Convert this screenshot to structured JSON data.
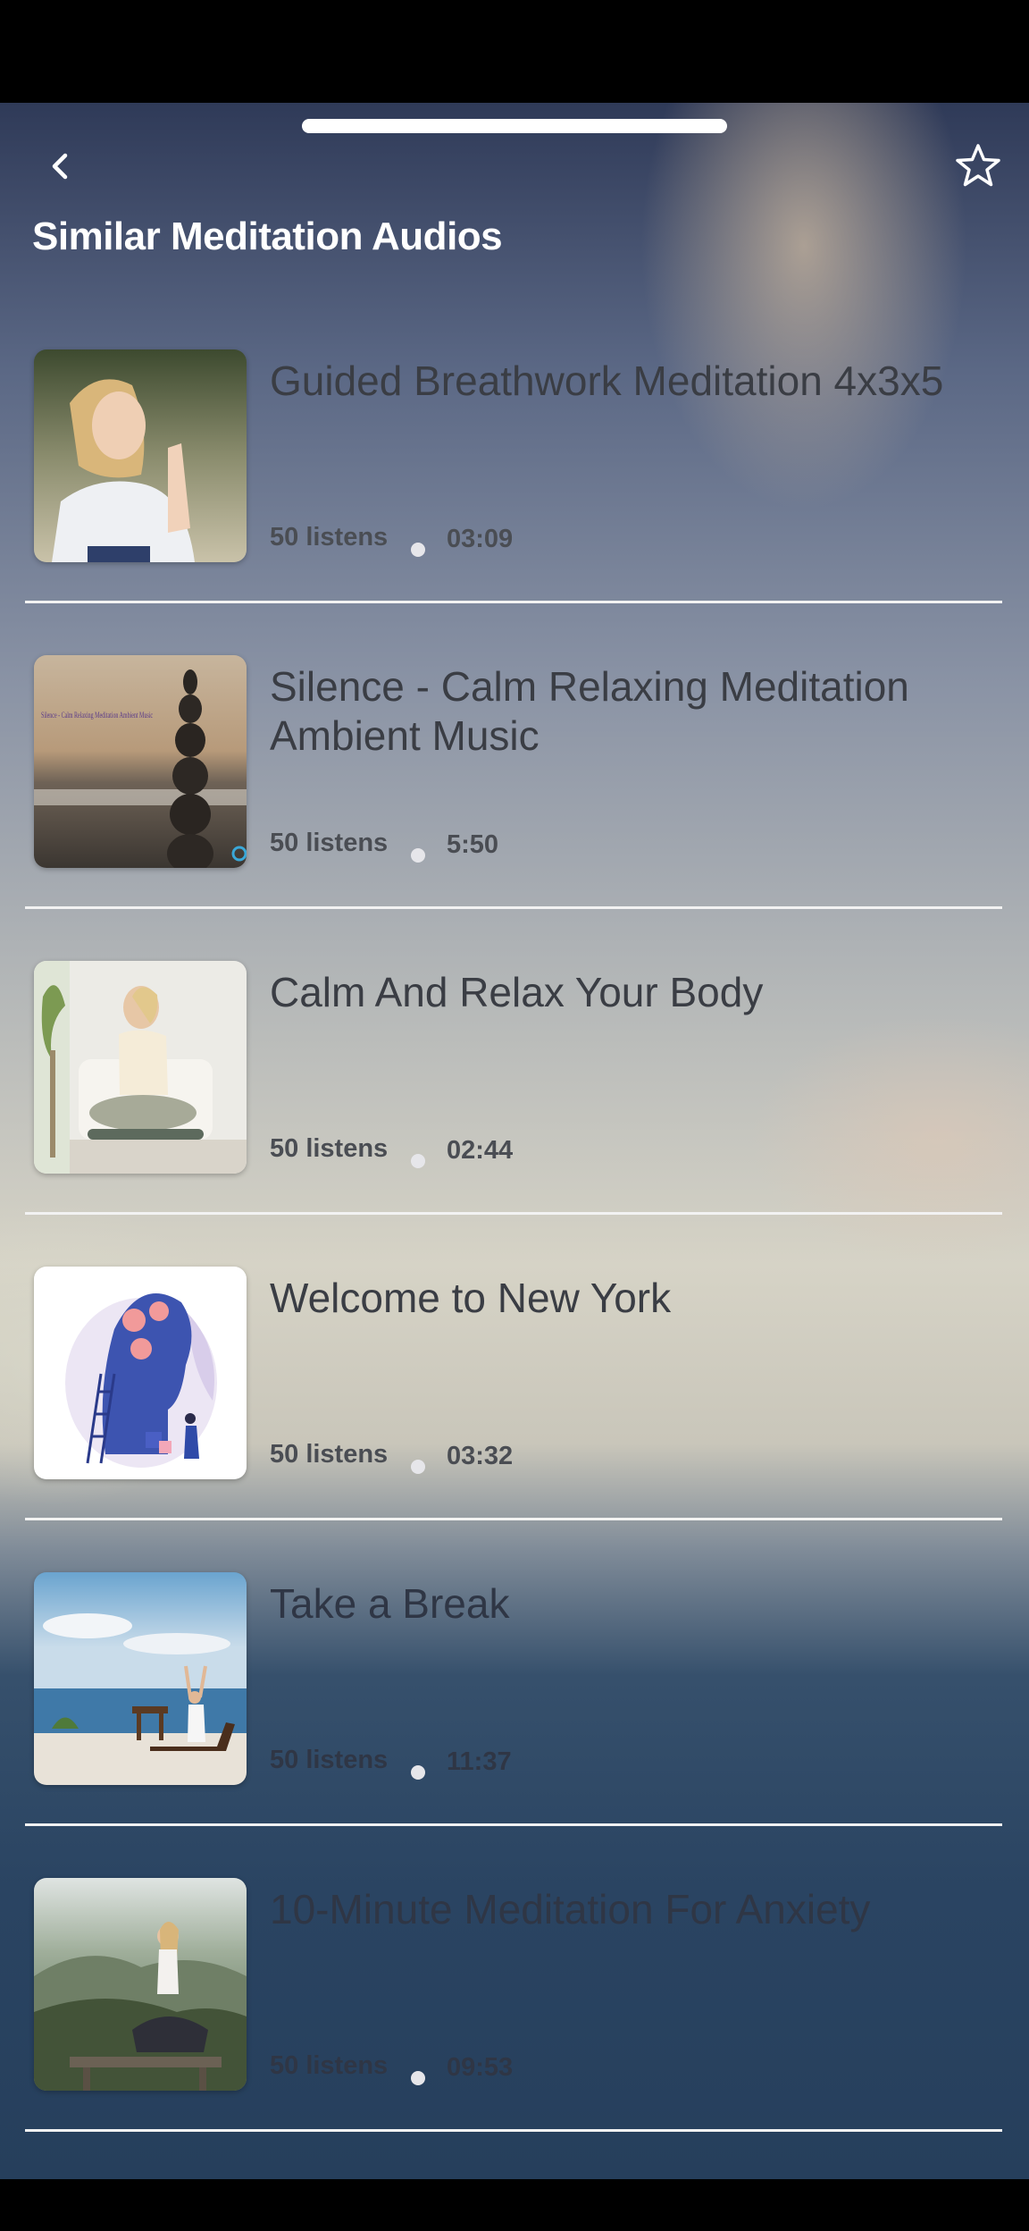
{
  "screen": {
    "title": "Similar Meditation Audios",
    "back_icon": "chevron-left-icon",
    "favorite_icon": "star-outline-icon"
  },
  "items": [
    {
      "title": "Guided Breathwork Meditation 4x3x5",
      "listens": "50 listens",
      "duration": "03:09",
      "thumb": "woman-praying-hands"
    },
    {
      "title": "Silence - Calm Relaxing Meditation Ambient Music",
      "listens": "50 listens",
      "duration": "5:50",
      "thumb": "stone-stack-sea",
      "thumb_text": "Silence - Calm Relaxing Meditation Ambient Music"
    },
    {
      "title": "Calm And Relax Your Body",
      "listens": "50 listens",
      "duration": "02:44",
      "thumb": "woman-lotus-living-room"
    },
    {
      "title": "Welcome to New York",
      "listens": "50 listens",
      "duration": "03:32",
      "thumb": "head-illustration-ladder"
    },
    {
      "title": "Take a Break",
      "listens": "50 listens",
      "duration": "11:37",
      "thumb": "woman-stretching-sea-terrace"
    },
    {
      "title": "10-Minute Meditation For Anxiety",
      "listens": "50 listens",
      "duration": "09:53",
      "thumb": "woman-meditating-mountains"
    }
  ],
  "colors": {
    "title_text": "#ffffff",
    "item_text": "#3a3d44",
    "divider": "#f2f2f2"
  }
}
